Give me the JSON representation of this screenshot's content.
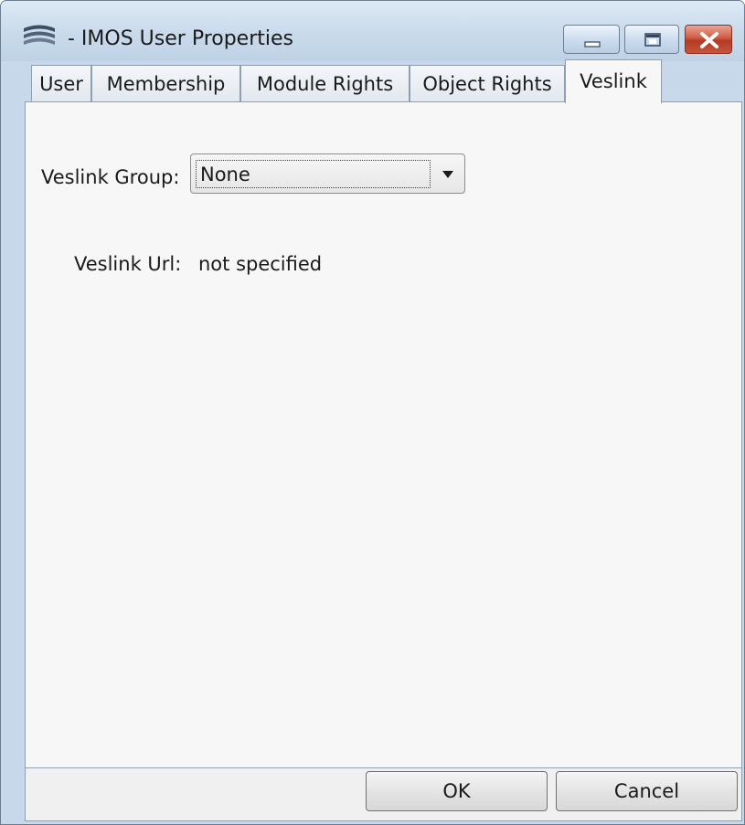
{
  "window": {
    "title": "- IMOS User Properties",
    "icon": "app-logo-icon"
  },
  "title_controls": {
    "minimize_icon": "minimize-icon",
    "maximize_icon": "maximize-icon",
    "close_icon": "close-icon"
  },
  "tabs": [
    {
      "label": "User",
      "active": false
    },
    {
      "label": "Membership",
      "active": false
    },
    {
      "label": "Module Rights",
      "active": false
    },
    {
      "label": "Object Rights",
      "active": false
    },
    {
      "label": "Veslink",
      "active": true
    }
  ],
  "veslink": {
    "group_label": "Veslink Group:",
    "group_value": "None",
    "url_label": "Veslink Url:",
    "url_value": "not specified"
  },
  "buttons": {
    "ok_label": "OK",
    "cancel_label": "Cancel"
  },
  "colors": {
    "close_button": "#c8553c",
    "panel_background": "#f7f7f7",
    "frame": "#c6d8ea"
  }
}
